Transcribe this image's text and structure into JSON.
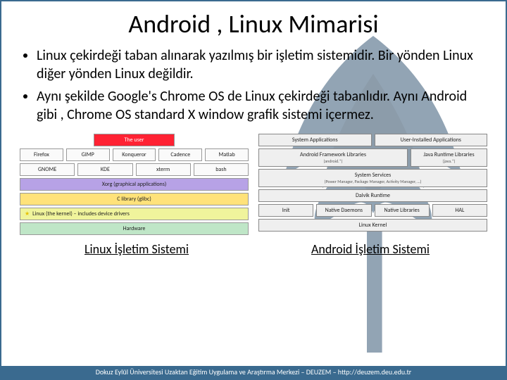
{
  "title": "Android , Linux Mimarisi",
  "bullets": [
    "Linux çekirdeği taban alınarak yazılmış bir işletim sistemidir. Bir yönden Linux diğer yönden Linux değildir.",
    "Aynı şekilde Google's Chrome OS de Linux çekirdeği tabanlıdır. Aynı Android gibi , Chrome OS standard X window grafik sistemi içermez."
  ],
  "linux": {
    "user": "The user",
    "apps_row1": [
      "Firefox",
      "GIMP",
      "Konqueror",
      "Cadence",
      "Matlab"
    ],
    "apps_row2": [
      "GNOME",
      "KDE",
      "xterm",
      "bash"
    ],
    "xorg": "Xorg (graphical applications)",
    "clib": "C library (glibc)",
    "kernel": "Linux (the kernel) – includes device drivers",
    "hardware": "Hardware"
  },
  "android": {
    "row1": [
      "System Applications",
      "User-Installed Applications"
    ],
    "row2_label": "Android Framework Libraries",
    "row2_sub": "(android.*)",
    "row2_right": "Java Runtime Libraries",
    "row2_right_sub": "(java.*)",
    "row3_label": "System Services",
    "row3_sub": "(Power Manager, Package Manager, Activity Manager, …)",
    "row4": "Dalvik Runtime",
    "row5": [
      "Init",
      "Native Daemons",
      "Native Libraries",
      "HAL"
    ],
    "row6": "Linux Kernel"
  },
  "captions": {
    "left": "Linux İşletim Sistemi",
    "right": "Android İşletim Sistemi"
  },
  "footer": "Dokuz Eylül Üniversitesi Uzaktan Eğitim Uygulama ve Araştırma Merkezi – DEUZEM – http://deuzem.deu.edu.tr"
}
